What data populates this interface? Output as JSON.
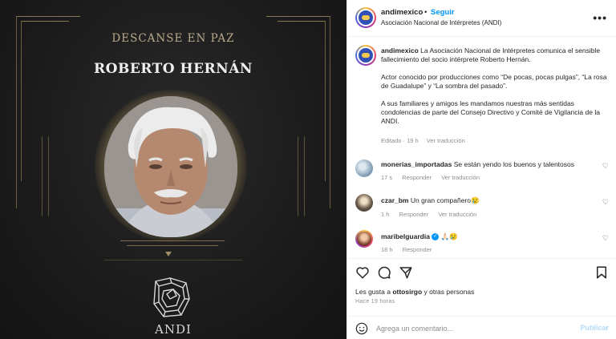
{
  "image": {
    "rip_title": "DESCANSE EN PAZ",
    "person_name": "ROBERTO HERNÁN",
    "logo_text": "ANDI"
  },
  "header": {
    "username": "andimexico",
    "separator": "•",
    "follow_label": "Seguir",
    "subtitle": "Asociación Nacional de Intérpretes (ANDI)",
    "more_icon": "more-horizontal-icon"
  },
  "caption": {
    "username": "andimexico",
    "paragraph1": "La Asociación Nacional de Intérpretes comunica el sensible fallecimiento del socio intérprete Roberto Hernán.",
    "paragraph2": "Actor conocido por producciones como “De pocas, pocas pulgas”, “La rosa de Guadalupe” y “La sombra del pasado”.",
    "paragraph3": "A sus familiares y amigos les mandamos nuestras más sentidas condolencias de parte del Consejo Directivo y Comité de Vigilancia de la ANDI.",
    "edited": "Editado · 19 h",
    "translate": "Ver traducción"
  },
  "comments": [
    {
      "username": "monerias_importadas",
      "text": "Se están yendo los buenos y talentosos",
      "time": "17 s",
      "reply": "Responder",
      "translate": "Ver traducción"
    },
    {
      "username": "czar_bm",
      "text": "Un gran compañero😢",
      "time": "1 h",
      "reply": "Responder",
      "translate": "Ver traducción"
    },
    {
      "username": "maribelguardia",
      "text": "🙏🏻😢",
      "time": "18 h",
      "reply": "Responder"
    }
  ],
  "likes": {
    "prefix": "Les gusta a",
    "user": "ottosirgo",
    "suffix": "y otras personas"
  },
  "time_ago": "Hace 19 horas",
  "add_comment": {
    "placeholder": "Agrega un comentario...",
    "publish_label": "Publicar"
  },
  "colors": {
    "link_blue": "#0095f6",
    "publish_disabled": "#b3dbff",
    "verified": "#0095f6",
    "panel_dark": "#1d1d1d"
  }
}
